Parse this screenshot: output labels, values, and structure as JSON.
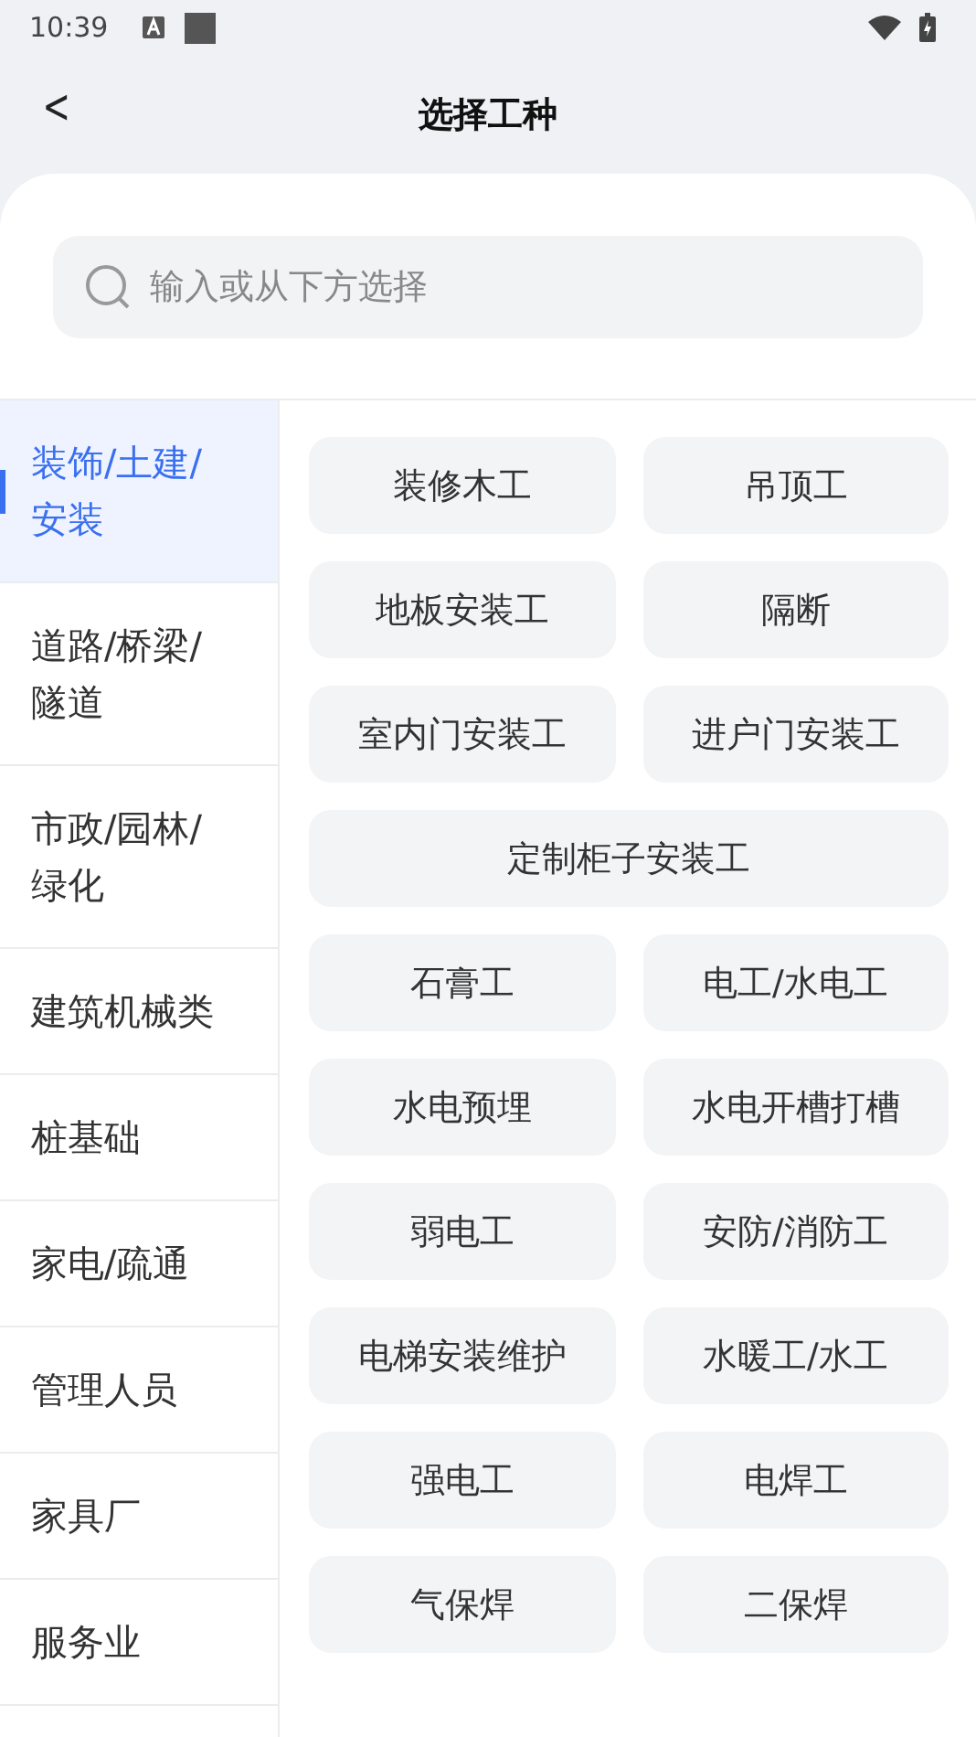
{
  "status_bar": {
    "time": "10:39"
  },
  "header": {
    "back": "<",
    "title": "选择工种"
  },
  "search": {
    "placeholder": "输入或从下方选择"
  },
  "categories": [
    {
      "label": "装饰/土建/安装",
      "selected": true
    },
    {
      "label": "道路/桥梁/隧道",
      "selected": false
    },
    {
      "label": "市政/园林/绿化",
      "selected": false
    },
    {
      "label": "建筑机械类",
      "selected": false
    },
    {
      "label": "桩基础",
      "selected": false
    },
    {
      "label": "家电/疏通",
      "selected": false
    },
    {
      "label": "管理人员",
      "selected": false
    },
    {
      "label": "家具厂",
      "selected": false
    },
    {
      "label": "服务业",
      "selected": false
    }
  ],
  "trades": [
    {
      "label": "装修木工",
      "wide": false
    },
    {
      "label": "吊顶工",
      "wide": false
    },
    {
      "label": "地板安装工",
      "wide": false
    },
    {
      "label": "隔断",
      "wide": false
    },
    {
      "label": "室内门安装工",
      "wide": false
    },
    {
      "label": "进户门安装工",
      "wide": false
    },
    {
      "label": "定制柜子安装工",
      "wide": true
    },
    {
      "label": "石膏工",
      "wide": false
    },
    {
      "label": "电工/水电工",
      "wide": false
    },
    {
      "label": "水电预埋",
      "wide": false
    },
    {
      "label": "水电开槽打槽",
      "wide": false
    },
    {
      "label": "弱电工",
      "wide": false
    },
    {
      "label": "安防/消防工",
      "wide": false
    },
    {
      "label": "电梯安装维护",
      "wide": false
    },
    {
      "label": "水暖工/水工",
      "wide": false
    },
    {
      "label": "强电工",
      "wide": false
    },
    {
      "label": "电焊工",
      "wide": false
    },
    {
      "label": "气保焊",
      "wide": false
    },
    {
      "label": "二保焊",
      "wide": false
    }
  ]
}
